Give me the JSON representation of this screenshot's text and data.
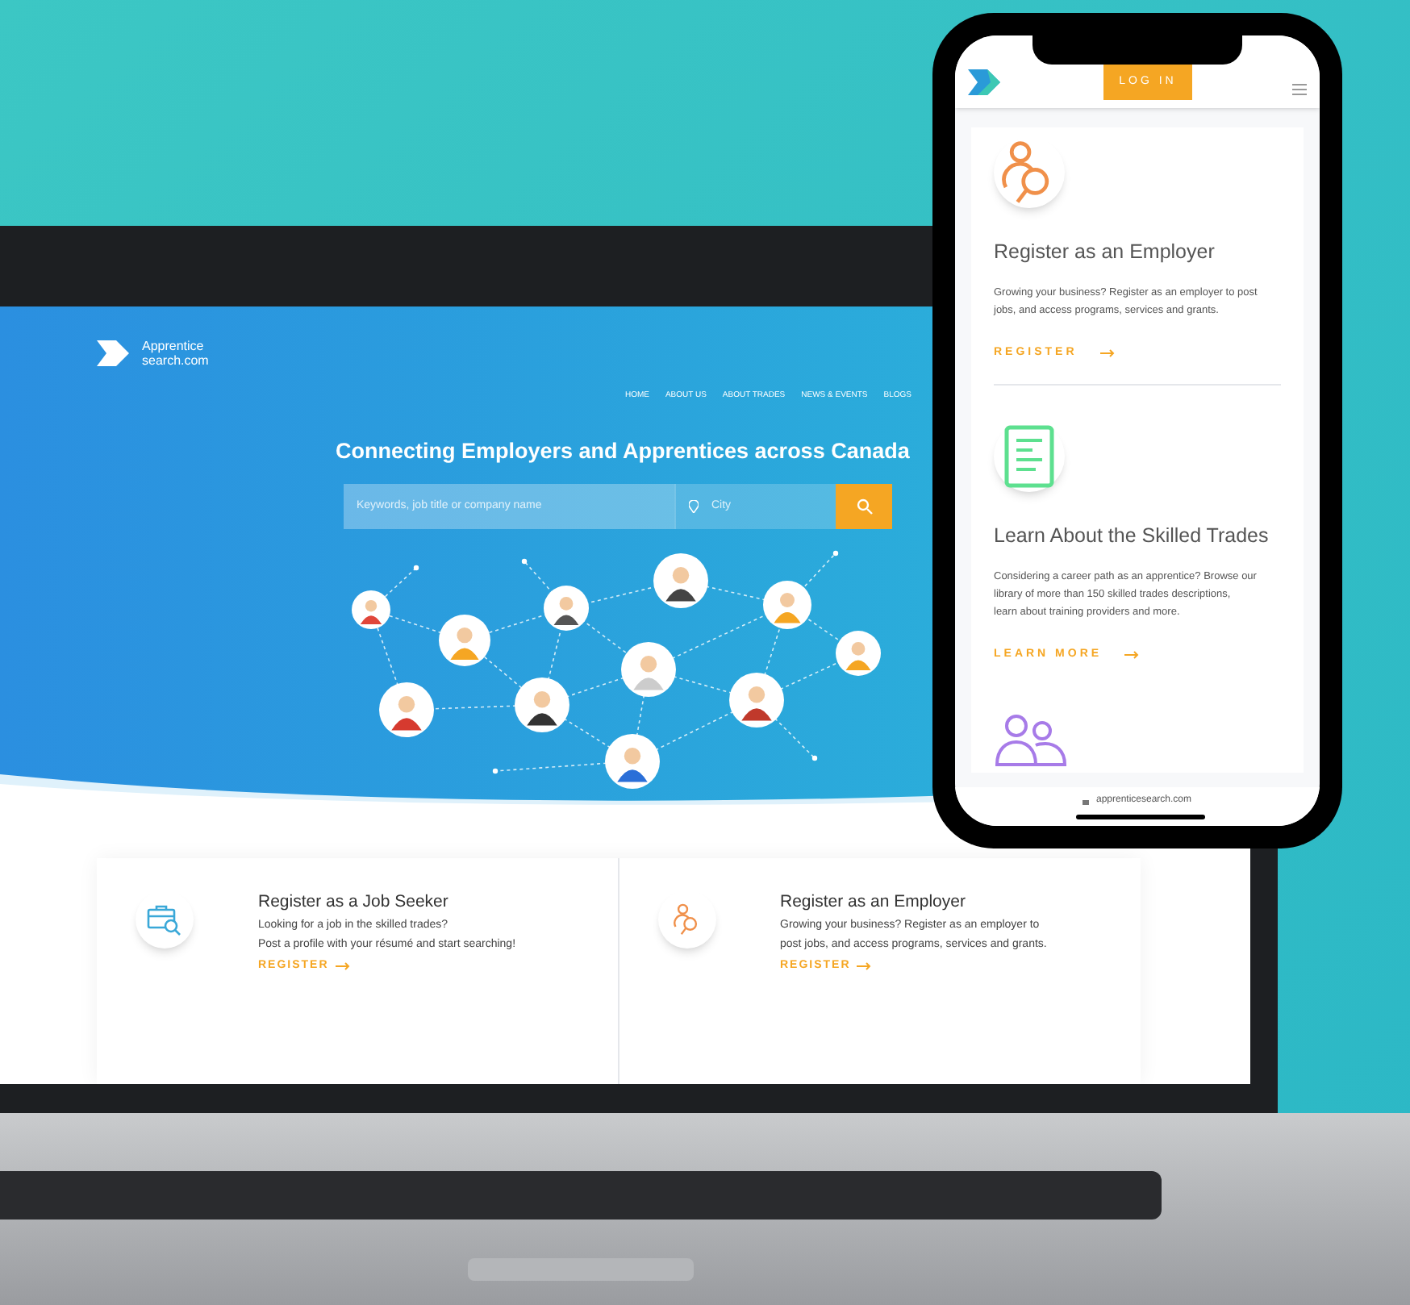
{
  "laptop_site": {
    "logo": [
      "Apprentice",
      "search.com"
    ],
    "nav": [
      "HOME",
      "ABOUT US",
      "ABOUT TRADES",
      "NEWS & EVENTS",
      "BLOGS"
    ],
    "headline": "Connecting Employers and Apprentices across Canada",
    "search": {
      "placeholder": "Keywords, job title or company name"
    },
    "city": {
      "placeholder": "City"
    },
    "cards": [
      {
        "title": "Register as a Job Seeker",
        "lines": [
          "Looking for a job in the skilled trades?",
          "Post a profile with your résumé and start searching!"
        ],
        "link": "REGISTER"
      },
      {
        "title": "Register as an Employer",
        "lines": [
          "Growing your business? Register as an employer to",
          "post jobs, and access programs, services and grants."
        ],
        "link": "REGISTER"
      }
    ]
  },
  "phone_site": {
    "login": "LOG IN",
    "cards": [
      {
        "title": "Register as an Employer",
        "lines": [
          "Growing your business? Register as an employer to post jobs, and access programs, services and grants."
        ],
        "link": "REGISTER"
      },
      {
        "title": "Learn About the Skilled Trades",
        "lines": [
          "Considering a career path as an apprentice? Browse our library of more than 150 skilled trades descriptions,",
          "learn about training providers and more."
        ],
        "link": "LEARN MORE"
      }
    ],
    "url": "apprenticesearch.com"
  }
}
